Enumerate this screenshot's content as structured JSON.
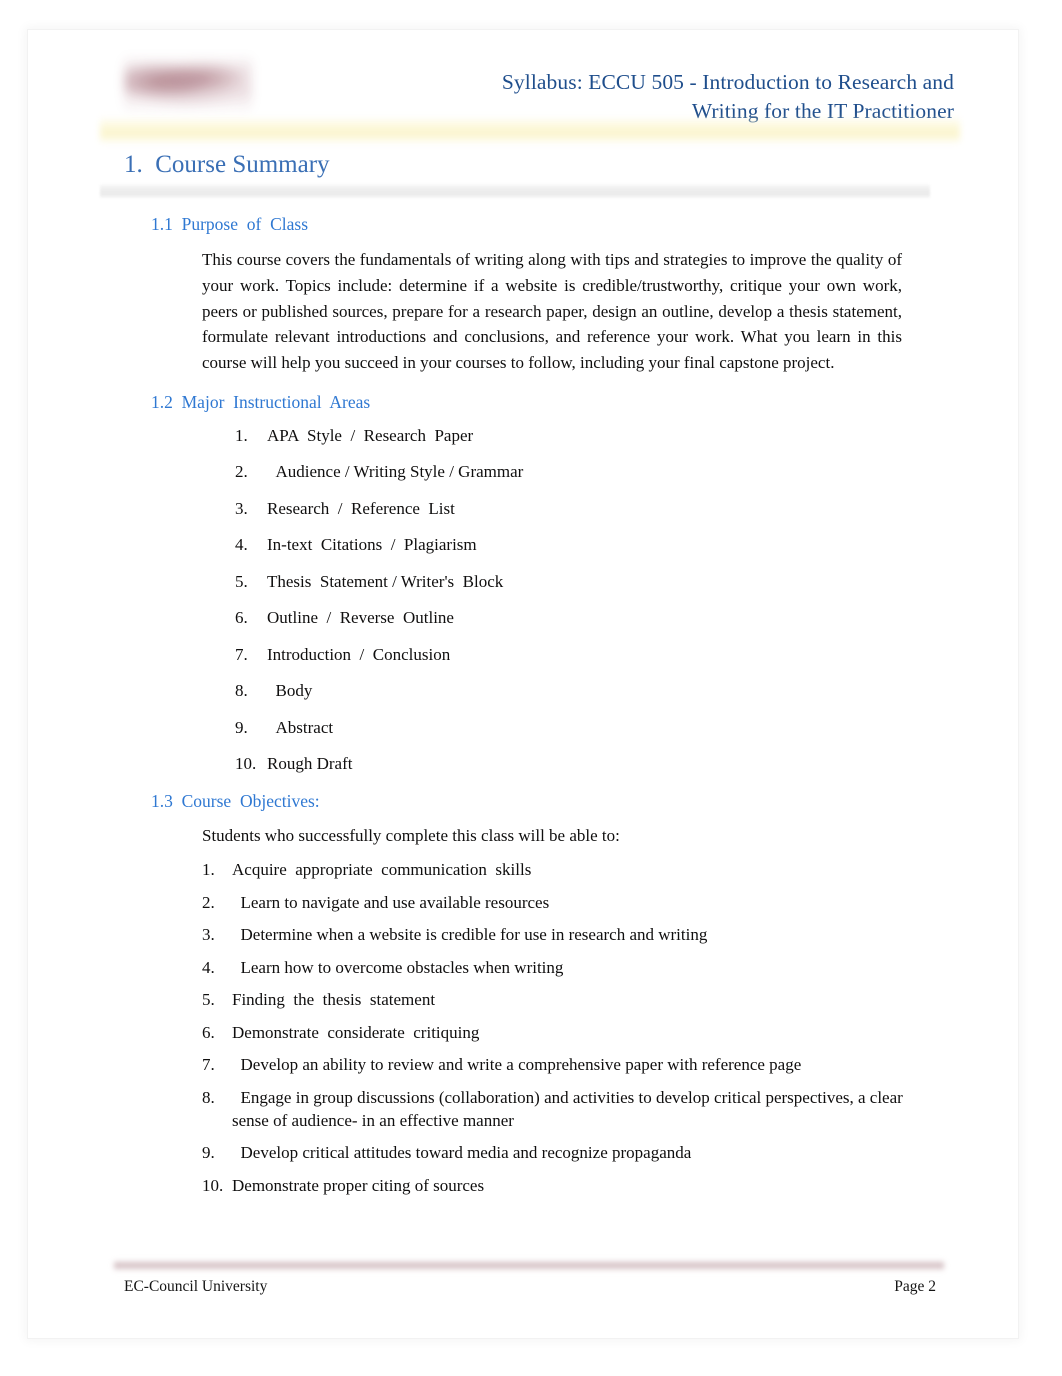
{
  "document": {
    "header": {
      "logo_icon": "ec-council-university-logo",
      "title_line1": "Syllabus: ECCU 505 - Introduction to Research and",
      "title_line2": "Writing for the IT Practitioner",
      "title_color": "#1f4e8c"
    },
    "section": {
      "number_and_title": "1.  Course Summary",
      "heading_color": "#3a6fb5"
    },
    "subsections": {
      "purpose": {
        "heading": "1.1  Purpose  of  Class",
        "body": "This course covers the fundamentals of writing along with tips and strategies to improve the quality of your work. Topics include: determine if a website is credible/trustworthy, critique your own work, peers or published sources, prepare for a research paper, design an outline, develop a thesis statement, formulate relevant introductions and conclusions, and reference your work. What you learn in this course will help you succeed in your courses to follow, including your final capstone project."
      },
      "instructional_areas": {
        "heading": "1.2  Major  Instructional  Areas",
        "items": [
          {
            "num": "1.",
            "text": "APA  Style  /  Research  Paper"
          },
          {
            "num": "2.",
            "text": "  Audience / Writing Style / Grammar"
          },
          {
            "num": "3.",
            "text": "Research  /  Reference  List"
          },
          {
            "num": "4.",
            "text": "In-text  Citations  /  Plagiarism"
          },
          {
            "num": "5.",
            "text": "Thesis  Statement / Writer's  Block"
          },
          {
            "num": "6.",
            "text": "Outline  /  Reverse  Outline"
          },
          {
            "num": "7.",
            "text": "Introduction  /  Conclusion"
          },
          {
            "num": "8.",
            "text": "  Body"
          },
          {
            "num": "9.",
            "text": "  Abstract"
          },
          {
            "num": "10.",
            "text": "Rough Draft"
          }
        ]
      },
      "objectives": {
        "heading": "1.3  Course  Objectives:",
        "intro": "Students who successfully complete this class will be able to:",
        "items": [
          {
            "num": "1.",
            "text": "Acquire  appropriate  communication  skills"
          },
          {
            "num": "2.",
            "text": "  Learn to navigate and use available resources"
          },
          {
            "num": "3.",
            "text": "  Determine when a website is credible for use in research and writing"
          },
          {
            "num": "4.",
            "text": "  Learn how to overcome obstacles when writing"
          },
          {
            "num": "5.",
            "text": "Finding  the  thesis  statement"
          },
          {
            "num": "6.",
            "text": "Demonstrate  considerate  critiquing"
          },
          {
            "num": "7.",
            "text": "  Develop an ability to review and write a comprehensive paper with reference page"
          },
          {
            "num": "8.",
            "text": "  Engage in group discussions (collaboration) and activities to develop critical perspectives, a clear sense of audience- in an effective manner"
          },
          {
            "num": "9.",
            "text": "  Develop critical attitudes toward media and recognize propaganda"
          },
          {
            "num": "10.",
            "text": "Demonstrate proper citing of sources"
          }
        ]
      }
    },
    "footer": {
      "left": "EC-Council University",
      "right": "Page 2"
    }
  }
}
